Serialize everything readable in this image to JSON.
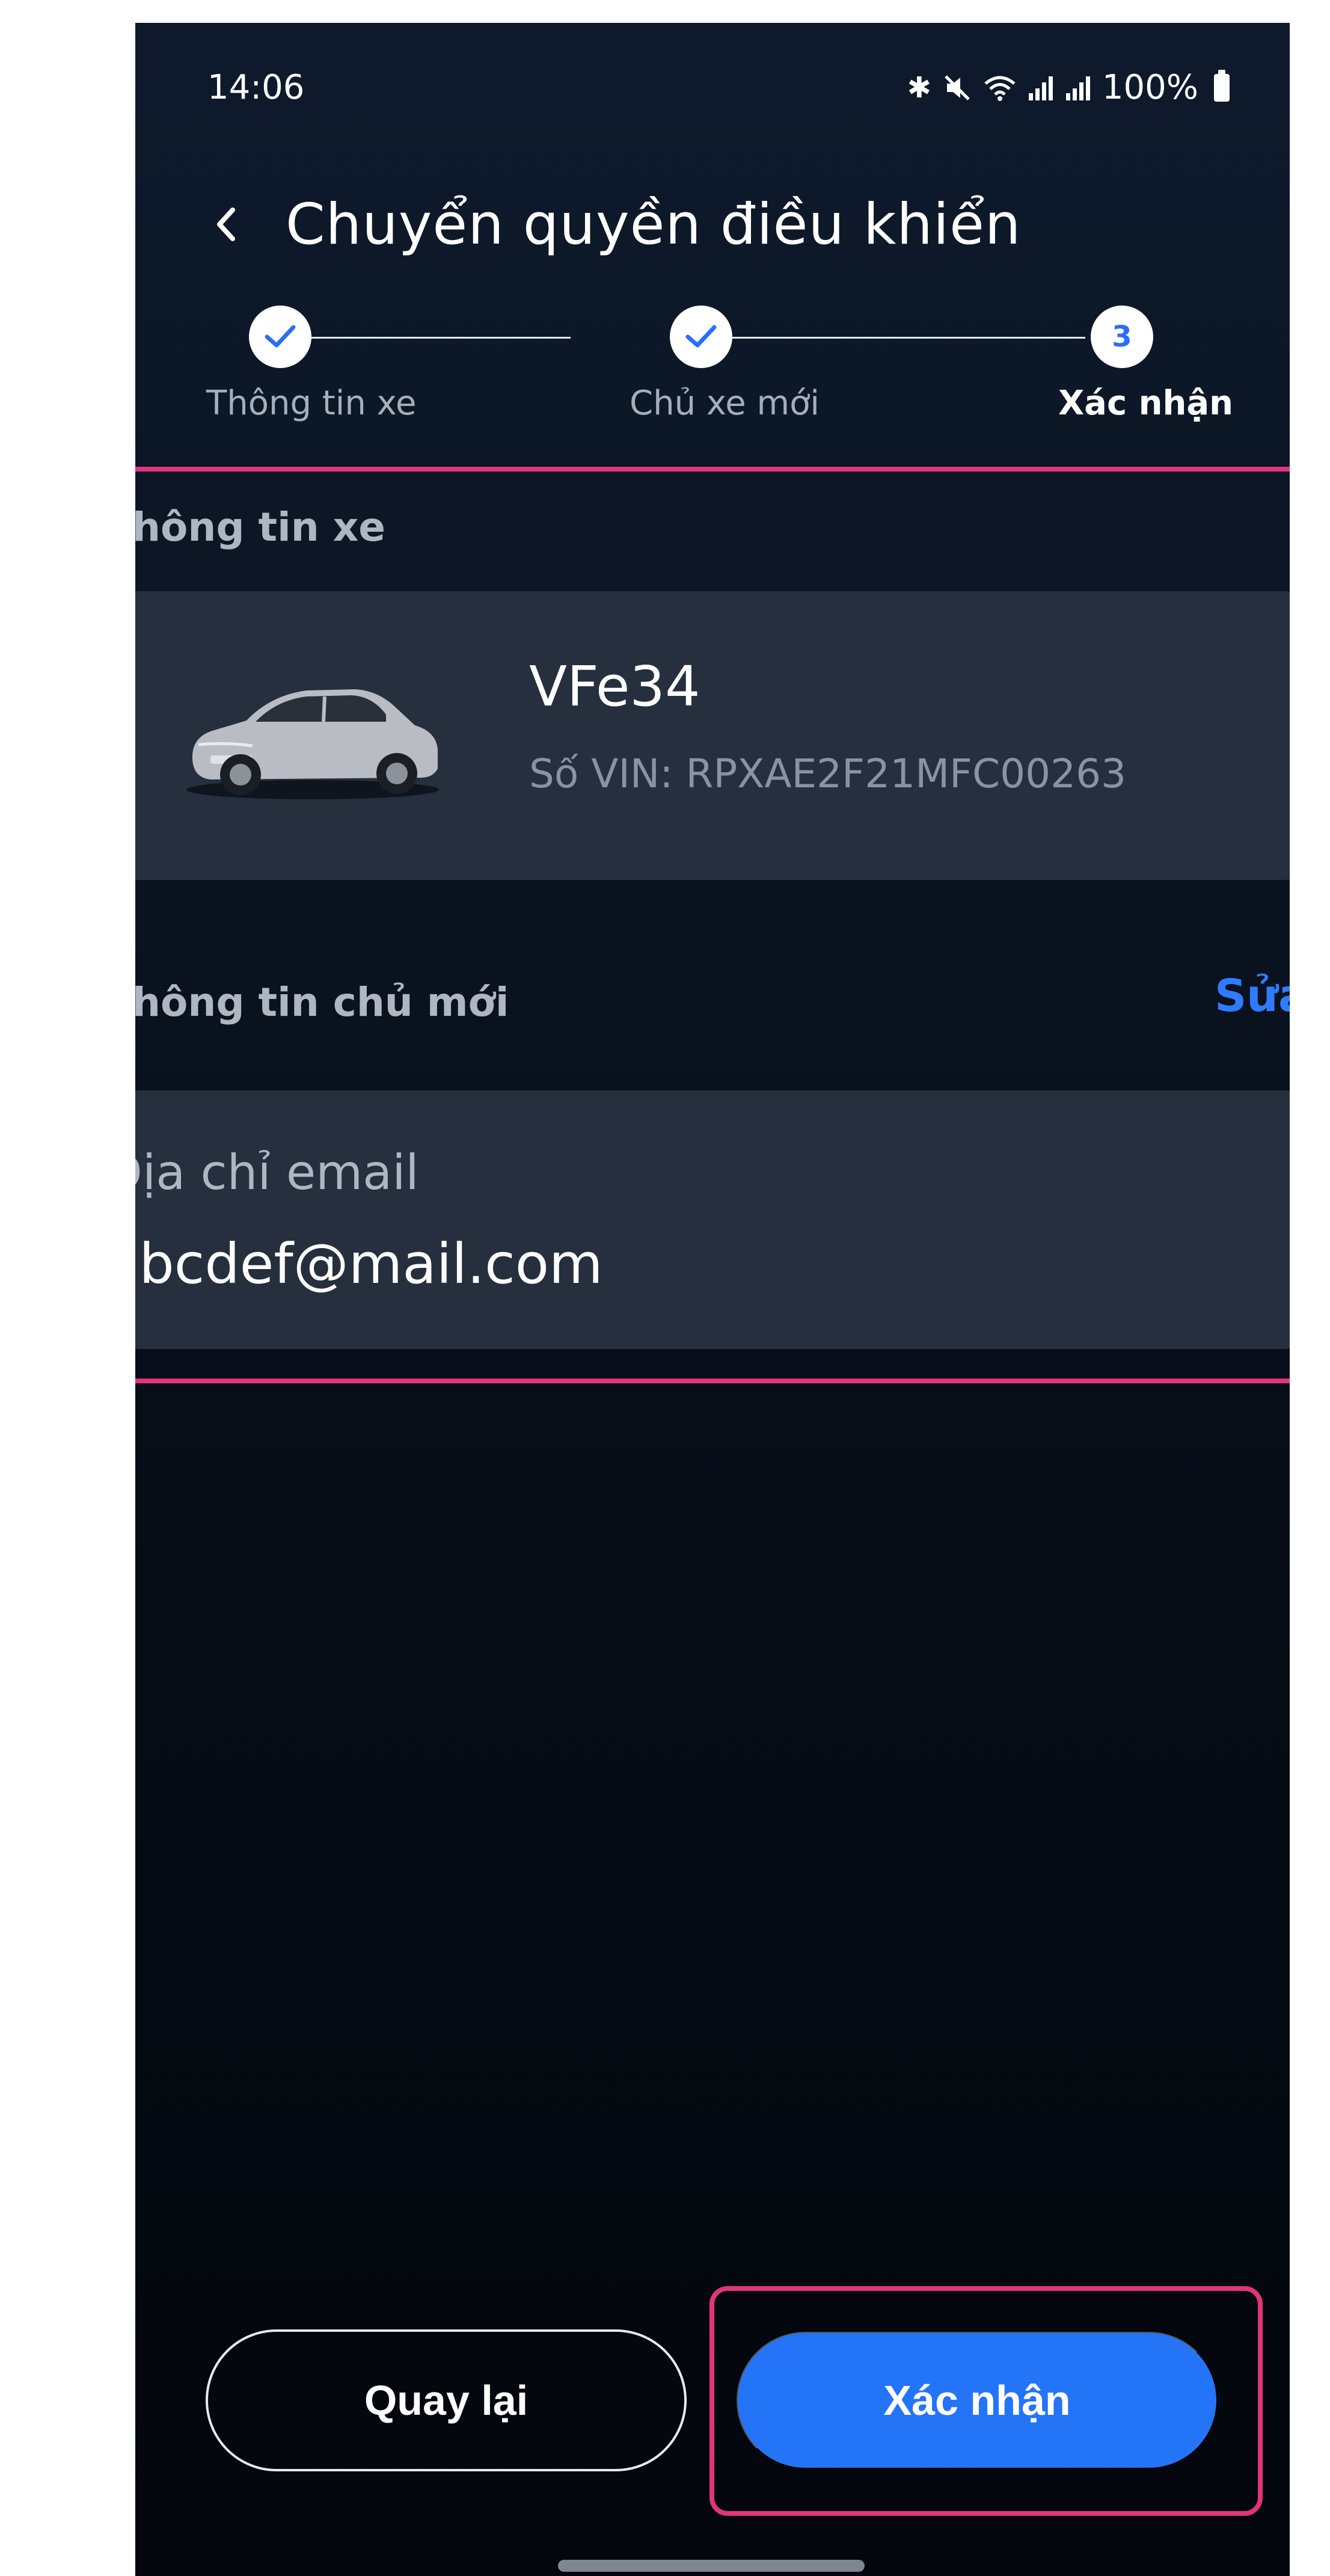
{
  "status_bar": {
    "time": "14:06",
    "battery": "100%",
    "icons": [
      "bluetooth-icon",
      "mute-icon",
      "wifi-icon",
      "signal-icon",
      "signal-icon",
      "battery-icon"
    ]
  },
  "header": {
    "title": "Chuyển quyền điều khiển",
    "back_icon": "chevron-left-icon"
  },
  "stepper": {
    "steps": [
      {
        "label": "Thông tin xe",
        "state": "done"
      },
      {
        "label": "Chủ xe mới",
        "state": "done"
      },
      {
        "label": "Xác nhận",
        "state": "active",
        "number": "3"
      }
    ]
  },
  "vehicle_section": {
    "title": "Thông tin xe",
    "car_name": "VFe34",
    "vin": "Số VIN: RPXAE2F21MFC00263"
  },
  "owner_section": {
    "title": "Thông tin chủ mới",
    "edit_label": "Sửa",
    "email_label": "Địa chỉ email",
    "email_value": "abcdef@mail.com"
  },
  "actions": {
    "back_label": "Quay lại",
    "confirm_label": "Xác nhận"
  },
  "colors": {
    "accent": "#2474F8",
    "highlight": "#E0357A",
    "card": "#262F3D",
    "background": "#0A1320"
  }
}
